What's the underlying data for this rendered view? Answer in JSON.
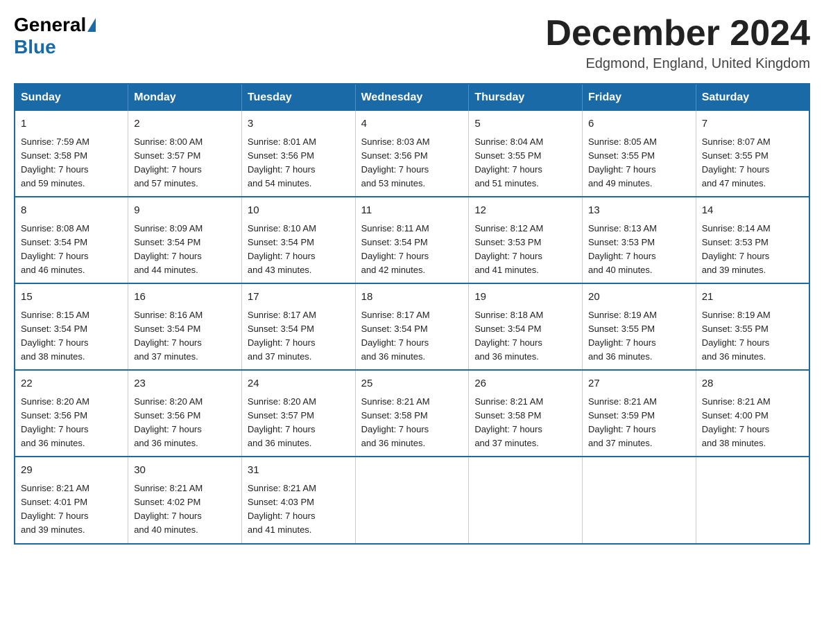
{
  "header": {
    "logo_general": "General",
    "logo_blue": "Blue",
    "month_title": "December 2024",
    "location": "Edgmond, England, United Kingdom"
  },
  "weekdays": [
    "Sunday",
    "Monday",
    "Tuesday",
    "Wednesday",
    "Thursday",
    "Friday",
    "Saturday"
  ],
  "weeks": [
    [
      {
        "day": "1",
        "info": "Sunrise: 7:59 AM\nSunset: 3:58 PM\nDaylight: 7 hours\nand 59 minutes."
      },
      {
        "day": "2",
        "info": "Sunrise: 8:00 AM\nSunset: 3:57 PM\nDaylight: 7 hours\nand 57 minutes."
      },
      {
        "day": "3",
        "info": "Sunrise: 8:01 AM\nSunset: 3:56 PM\nDaylight: 7 hours\nand 54 minutes."
      },
      {
        "day": "4",
        "info": "Sunrise: 8:03 AM\nSunset: 3:56 PM\nDaylight: 7 hours\nand 53 minutes."
      },
      {
        "day": "5",
        "info": "Sunrise: 8:04 AM\nSunset: 3:55 PM\nDaylight: 7 hours\nand 51 minutes."
      },
      {
        "day": "6",
        "info": "Sunrise: 8:05 AM\nSunset: 3:55 PM\nDaylight: 7 hours\nand 49 minutes."
      },
      {
        "day": "7",
        "info": "Sunrise: 8:07 AM\nSunset: 3:55 PM\nDaylight: 7 hours\nand 47 minutes."
      }
    ],
    [
      {
        "day": "8",
        "info": "Sunrise: 8:08 AM\nSunset: 3:54 PM\nDaylight: 7 hours\nand 46 minutes."
      },
      {
        "day": "9",
        "info": "Sunrise: 8:09 AM\nSunset: 3:54 PM\nDaylight: 7 hours\nand 44 minutes."
      },
      {
        "day": "10",
        "info": "Sunrise: 8:10 AM\nSunset: 3:54 PM\nDaylight: 7 hours\nand 43 minutes."
      },
      {
        "day": "11",
        "info": "Sunrise: 8:11 AM\nSunset: 3:54 PM\nDaylight: 7 hours\nand 42 minutes."
      },
      {
        "day": "12",
        "info": "Sunrise: 8:12 AM\nSunset: 3:53 PM\nDaylight: 7 hours\nand 41 minutes."
      },
      {
        "day": "13",
        "info": "Sunrise: 8:13 AM\nSunset: 3:53 PM\nDaylight: 7 hours\nand 40 minutes."
      },
      {
        "day": "14",
        "info": "Sunrise: 8:14 AM\nSunset: 3:53 PM\nDaylight: 7 hours\nand 39 minutes."
      }
    ],
    [
      {
        "day": "15",
        "info": "Sunrise: 8:15 AM\nSunset: 3:54 PM\nDaylight: 7 hours\nand 38 minutes."
      },
      {
        "day": "16",
        "info": "Sunrise: 8:16 AM\nSunset: 3:54 PM\nDaylight: 7 hours\nand 37 minutes."
      },
      {
        "day": "17",
        "info": "Sunrise: 8:17 AM\nSunset: 3:54 PM\nDaylight: 7 hours\nand 37 minutes."
      },
      {
        "day": "18",
        "info": "Sunrise: 8:17 AM\nSunset: 3:54 PM\nDaylight: 7 hours\nand 36 minutes."
      },
      {
        "day": "19",
        "info": "Sunrise: 8:18 AM\nSunset: 3:54 PM\nDaylight: 7 hours\nand 36 minutes."
      },
      {
        "day": "20",
        "info": "Sunrise: 8:19 AM\nSunset: 3:55 PM\nDaylight: 7 hours\nand 36 minutes."
      },
      {
        "day": "21",
        "info": "Sunrise: 8:19 AM\nSunset: 3:55 PM\nDaylight: 7 hours\nand 36 minutes."
      }
    ],
    [
      {
        "day": "22",
        "info": "Sunrise: 8:20 AM\nSunset: 3:56 PM\nDaylight: 7 hours\nand 36 minutes."
      },
      {
        "day": "23",
        "info": "Sunrise: 8:20 AM\nSunset: 3:56 PM\nDaylight: 7 hours\nand 36 minutes."
      },
      {
        "day": "24",
        "info": "Sunrise: 8:20 AM\nSunset: 3:57 PM\nDaylight: 7 hours\nand 36 minutes."
      },
      {
        "day": "25",
        "info": "Sunrise: 8:21 AM\nSunset: 3:58 PM\nDaylight: 7 hours\nand 36 minutes."
      },
      {
        "day": "26",
        "info": "Sunrise: 8:21 AM\nSunset: 3:58 PM\nDaylight: 7 hours\nand 37 minutes."
      },
      {
        "day": "27",
        "info": "Sunrise: 8:21 AM\nSunset: 3:59 PM\nDaylight: 7 hours\nand 37 minutes."
      },
      {
        "day": "28",
        "info": "Sunrise: 8:21 AM\nSunset: 4:00 PM\nDaylight: 7 hours\nand 38 minutes."
      }
    ],
    [
      {
        "day": "29",
        "info": "Sunrise: 8:21 AM\nSunset: 4:01 PM\nDaylight: 7 hours\nand 39 minutes."
      },
      {
        "day": "30",
        "info": "Sunrise: 8:21 AM\nSunset: 4:02 PM\nDaylight: 7 hours\nand 40 minutes."
      },
      {
        "day": "31",
        "info": "Sunrise: 8:21 AM\nSunset: 4:03 PM\nDaylight: 7 hours\nand 41 minutes."
      },
      {
        "day": "",
        "info": ""
      },
      {
        "day": "",
        "info": ""
      },
      {
        "day": "",
        "info": ""
      },
      {
        "day": "",
        "info": ""
      }
    ]
  ]
}
